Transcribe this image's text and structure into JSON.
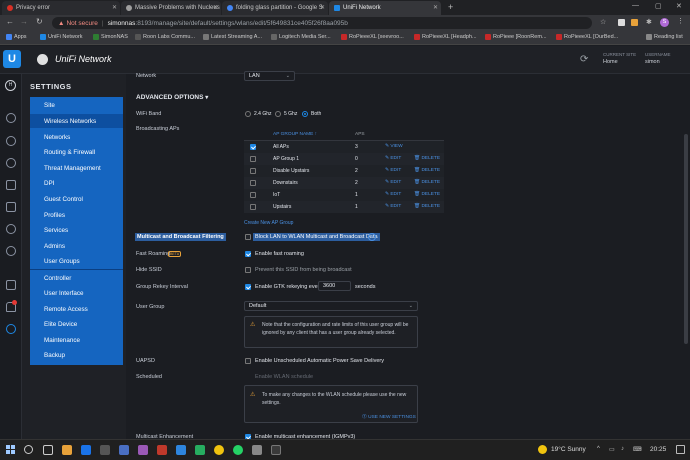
{
  "browser": {
    "tabs": [
      {
        "title": "Privacy error",
        "color": "#d93025",
        "active": false
      },
      {
        "title": "Massive Problems with Nucleus",
        "color": "#9e9e9e",
        "active": false
      },
      {
        "title": "folding glass partition - Google S",
        "color": "#4285f4",
        "active": false
      },
      {
        "title": "UniFi Network",
        "color": "#1e88e5",
        "active": true
      }
    ],
    "not_secure": "Not secure",
    "url_host": "simonnas",
    "url_path": ":8193/manage/site/default/settings/wlans/edit/5f649831ce405f26f8aa095b",
    "apps_label": "Apps",
    "reading_list": "Reading list",
    "profile_initial": "S",
    "bookmarks": [
      {
        "label": "UniFi Network",
        "color": "#1e88e5"
      },
      {
        "label": "SimonNAS",
        "color": "#2e7d32"
      },
      {
        "label": "Roon Labs Commu...",
        "color": "#555"
      },
      {
        "label": "Latest Streaming A...",
        "color": "#777"
      },
      {
        "label": "Logitech Media Ser...",
        "color": "#666"
      },
      {
        "label": "RoPieeeXL [xeevroo...",
        "color": "#c62828"
      },
      {
        "label": "RoPieeeXL [Headph...",
        "color": "#c62828"
      },
      {
        "label": "RoPieee [RoonRem...",
        "color": "#c62828"
      },
      {
        "label": "RoPieeeXL [OurBed...",
        "color": "#c62828"
      }
    ]
  },
  "header": {
    "brand": "UniFi Network",
    "current_site_label": "CURRENT SITE",
    "current_site": "Home",
    "username_label": "USERNAME",
    "username": "simon"
  },
  "sidebar": {
    "title": "SETTINGS",
    "items": [
      {
        "label": "Site",
        "selected": false
      },
      {
        "label": "Wireless Networks",
        "selected": true
      },
      {
        "label": "Networks",
        "selected": false
      },
      {
        "label": "Routing & Firewall",
        "selected": false
      },
      {
        "label": "Threat Management",
        "selected": false
      },
      {
        "label": "DPI",
        "selected": false
      },
      {
        "label": "Guest Control",
        "selected": false
      },
      {
        "label": "Profiles",
        "selected": false
      },
      {
        "label": "Services",
        "selected": false
      },
      {
        "label": "Admins",
        "selected": false
      },
      {
        "label": "User Groups",
        "selected": false
      }
    ],
    "items2": [
      {
        "label": "Controller"
      },
      {
        "label": "User Interface"
      },
      {
        "label": "Remote Access"
      },
      {
        "label": "Elite Device"
      },
      {
        "label": "Maintenance"
      },
      {
        "label": "Backup"
      }
    ]
  },
  "form": {
    "network_label": "Network",
    "network_value": "LAN",
    "advanced_title": "ADVANCED OPTIONS",
    "wifi_band_label": "WiFi Band",
    "bands": [
      "2.4 Ghz",
      "5 Ghz",
      "Both"
    ],
    "broadcasting_label": "Broadcasting APs",
    "ap_col_name": "AP GROUP NAME",
    "ap_col_aps": "APS",
    "ap_groups": [
      {
        "name": "All APs",
        "aps": "3",
        "checked": true,
        "actions": [
          "VIEW"
        ]
      },
      {
        "name": "AP Group 1",
        "aps": "0",
        "checked": false,
        "actions": [
          "EDIT",
          "DELETE"
        ]
      },
      {
        "name": "Disable Upstairs",
        "aps": "2",
        "checked": false,
        "actions": [
          "EDIT",
          "DELETE"
        ]
      },
      {
        "name": "Downstairs",
        "aps": "2",
        "checked": false,
        "actions": [
          "EDIT",
          "DELETE"
        ]
      },
      {
        "name": "IoT",
        "aps": "1",
        "checked": false,
        "actions": [
          "EDIT",
          "DELETE"
        ]
      },
      {
        "name": "Upstairs",
        "aps": "1",
        "checked": false,
        "actions": [
          "EDIT",
          "DELETE"
        ]
      }
    ],
    "create_ap_group": "Create New AP Group",
    "multicast_filter_label": "Multicast and Broadcast Filtering",
    "multicast_filter_text": "Block LAN to WLAN Multicast and Broadcast Data",
    "fast_roaming_label": "Fast Roaming",
    "fast_roaming_badge": "BETA",
    "fast_roaming_text": "Enable fast roaming",
    "hide_ssid_label": "Hide SSID",
    "hide_ssid_text": "Prevent this SSID from being broadcast",
    "rekey_label": "Group Rekey Interval",
    "rekey_text": "Enable GTK rekeying every",
    "rekey_value": "3600",
    "rekey_unit": "seconds",
    "user_group_label": "User Group",
    "user_group_value": "Default",
    "user_group_note": "Note that the configuration and rate limits of this user group will be ignored by any client that has a user group already selected.",
    "uapsd_label": "UAPSD",
    "uapsd_text": "Enable Unscheduled Automatic Power Save Delivery",
    "scheduled_label": "Scheduled",
    "scheduled_text": "Enable WLAN schedule",
    "schedule_note": "To make any changes to the WLAN schedule please use the new settings.",
    "use_new_settings": "USE NEW SETTINGS",
    "multicast_enh_label": "Multicast Enhancement",
    "multicast_enh_text": "Enable multicast enhancement (IGMPv3)"
  },
  "taskbar": {
    "weather": "19°C  Sunny",
    "time": "20:25"
  }
}
